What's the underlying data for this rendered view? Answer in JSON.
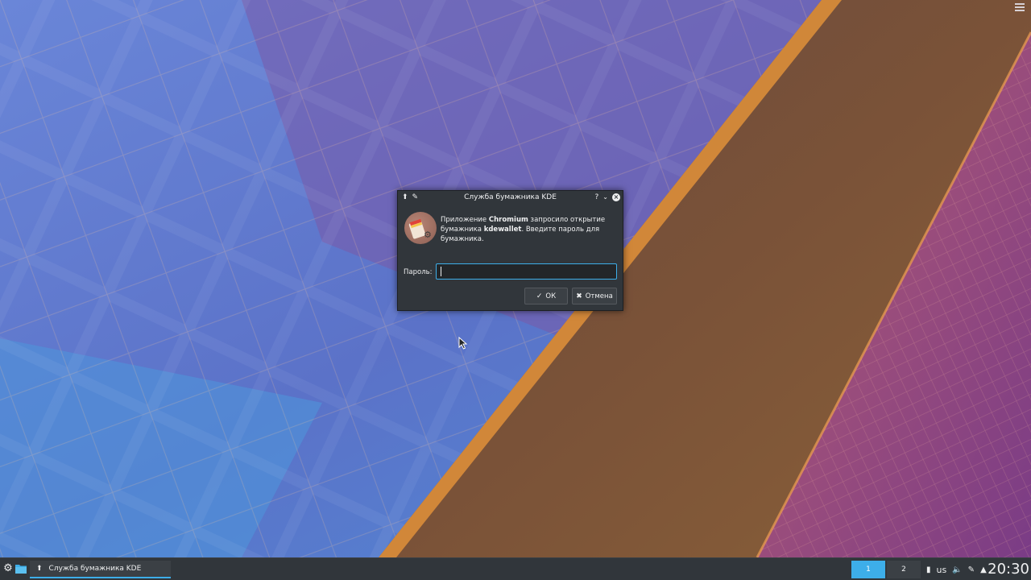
{
  "dialog": {
    "title": "Служба бумажника KDE",
    "help_label": "?",
    "message_pre": "Приложение ",
    "app_name": "Chromium",
    "message_mid": " запросило открытие бумажника ",
    "wallet_name": "kdewallet",
    "message_post": ". Введите пароль для бумажника.",
    "password_label": "Пароль:",
    "password_value": "",
    "ok_label": "ОК",
    "cancel_label": "Отмена"
  },
  "taskbar": {
    "task_label": "Служба бумажника KDE",
    "pager": [
      "1",
      "2"
    ],
    "keyboard_layout": "us",
    "clock": "20:30"
  },
  "colors": {
    "panel": "#31363b",
    "accent": "#3daee9",
    "text": "#eff0f1"
  },
  "icons": {
    "dialog_pin": "pin-icon",
    "dialog_keep_above": "keep-above-icon",
    "wallet": "kwallet-icon",
    "launcher": "kde-logo-icon",
    "files": "folder-icon",
    "tray": [
      "usb-icon",
      "volume-icon",
      "clipboard-icon",
      "arrow-up-icon"
    ]
  }
}
